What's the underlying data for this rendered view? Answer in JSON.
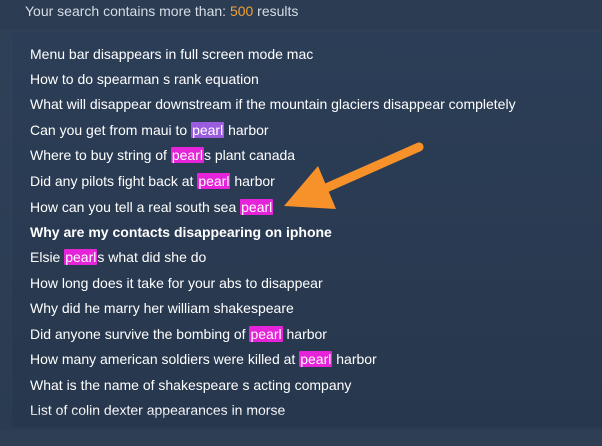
{
  "status": {
    "prefix": "Your search contains more than: ",
    "count": "500",
    "suffix": " results"
  },
  "highlight_colors": {
    "primary": "#e523d8",
    "soft": "#9b5ce0",
    "arrow": "#f7922b"
  },
  "results": [
    {
      "pre": "Menu bar disappears in full screen mode mac",
      "hl": "",
      "post": ""
    },
    {
      "pre": "How to do spearman s rank equation",
      "hl": "",
      "post": ""
    },
    {
      "pre": "What will disappear downstream if the mountain glaciers disappear completely",
      "hl": "",
      "post": ""
    },
    {
      "pre": "Can you get from maui to ",
      "hl": "pearl",
      "post": " harbor"
    },
    {
      "pre": "Where to buy string of ",
      "hl": "pearl",
      "post": "s plant canada"
    },
    {
      "pre": "Did any pilots fight back at ",
      "hl": "pearl",
      "post": " harbor"
    },
    {
      "pre": "How can you tell a real south sea ",
      "hl": "pearl",
      "post": ""
    },
    {
      "pre": "Why are my contacts disappearing on iphone",
      "hl": "",
      "post": ""
    },
    {
      "pre": "Elsie ",
      "hl": "pearl",
      "post": "s what did she do"
    },
    {
      "pre": "How long does it take for your abs to disappear",
      "hl": "",
      "post": ""
    },
    {
      "pre": "Why did he marry her william shakespeare",
      "hl": "",
      "post": ""
    },
    {
      "pre": "Did anyone survive the bombing of ",
      "hl": "pearl",
      "post": " harbor"
    },
    {
      "pre": "How many american soldiers were killed at ",
      "hl": "pearl",
      "post": " harbor"
    },
    {
      "pre": "What is the name of shakespeare s acting company",
      "hl": "",
      "post": ""
    },
    {
      "pre": "List of colin dexter appearances in morse",
      "hl": "",
      "post": ""
    }
  ]
}
